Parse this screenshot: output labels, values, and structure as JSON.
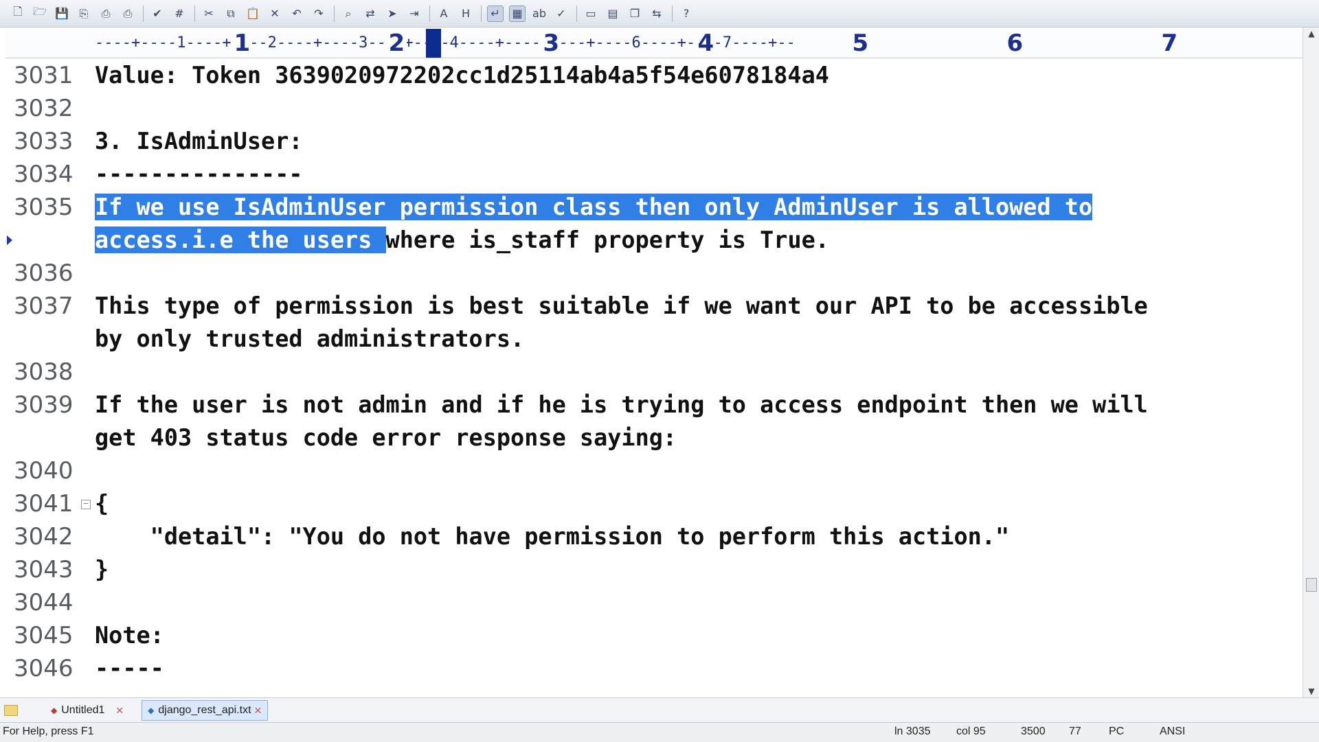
{
  "toolbar": {
    "buttons": [
      "new-file-icon",
      "open-folder-icon",
      "save-icon",
      "save-all-icon",
      "print-preview-icon",
      "print-icon",
      "spell-check-icon",
      "word-count-icon",
      "cut-icon",
      "copy-icon",
      "paste-icon",
      "delete-icon",
      "undo-icon",
      "redo-icon",
      "find-icon",
      "replace-icon",
      "goto-icon",
      "indent-icon",
      "font-icon",
      "hex-icon",
      "word-wrap-icon",
      "column-mode-icon",
      "spell-icon",
      "check-icon",
      "window-icon",
      "tile-icon",
      "cascade-icon",
      "toggle-icon",
      "help-icon"
    ]
  },
  "ruler": {
    "dashes": "----+----1----+----2----+----3----+----4----+----5----+----6----+----7----+--",
    "numbers": [
      "1",
      "2",
      "3",
      "4",
      "5",
      "6",
      "7"
    ]
  },
  "editor": {
    "lines": [
      {
        "num": "3031",
        "text": "Value: Token 3639020972202cc1d25114ab4a5f54e6078184a4"
      },
      {
        "num": "3032",
        "text": ""
      },
      {
        "num": "3033",
        "text": "3. IsAdminUser:"
      },
      {
        "num": "3034",
        "text": "---------------"
      },
      {
        "num": "3035",
        "selected": "If we use IsAdminUser permission class then only AdminUser is allowed to"
      },
      {
        "num": "",
        "selected": "access.i.e the users ",
        "text": "where is_staff property is True."
      },
      {
        "num": "3036",
        "text": ""
      },
      {
        "num": "3037",
        "text": "This type of permission is best suitable if we want our API to be accessible"
      },
      {
        "num": "",
        "text": "by only trusted administrators."
      },
      {
        "num": "3038",
        "text": ""
      },
      {
        "num": "3039",
        "text": "If the user is not admin and if he is trying to access endpoint then we will"
      },
      {
        "num": "",
        "text": "get 403 status code error response saying:"
      },
      {
        "num": "3040",
        "text": ""
      },
      {
        "num": "3041",
        "text": "{"
      },
      {
        "num": "3042",
        "text": "    \"detail\": \"You do not have permission to perform this action.\""
      },
      {
        "num": "3043",
        "text": "}"
      },
      {
        "num": "3044",
        "text": ""
      },
      {
        "num": "3045",
        "text": "Note:"
      },
      {
        "num": "3046",
        "text": "-----"
      }
    ]
  },
  "tabs": [
    {
      "label": "Untitled1"
    },
    {
      "label": "django_rest_api.txt"
    }
  ],
  "status": {
    "help": "For Help, press F1",
    "line": "ln 3035",
    "col": "col 95",
    "total": "3500",
    "num": "77",
    "mode": "PC",
    "encoding": "ANSI"
  }
}
